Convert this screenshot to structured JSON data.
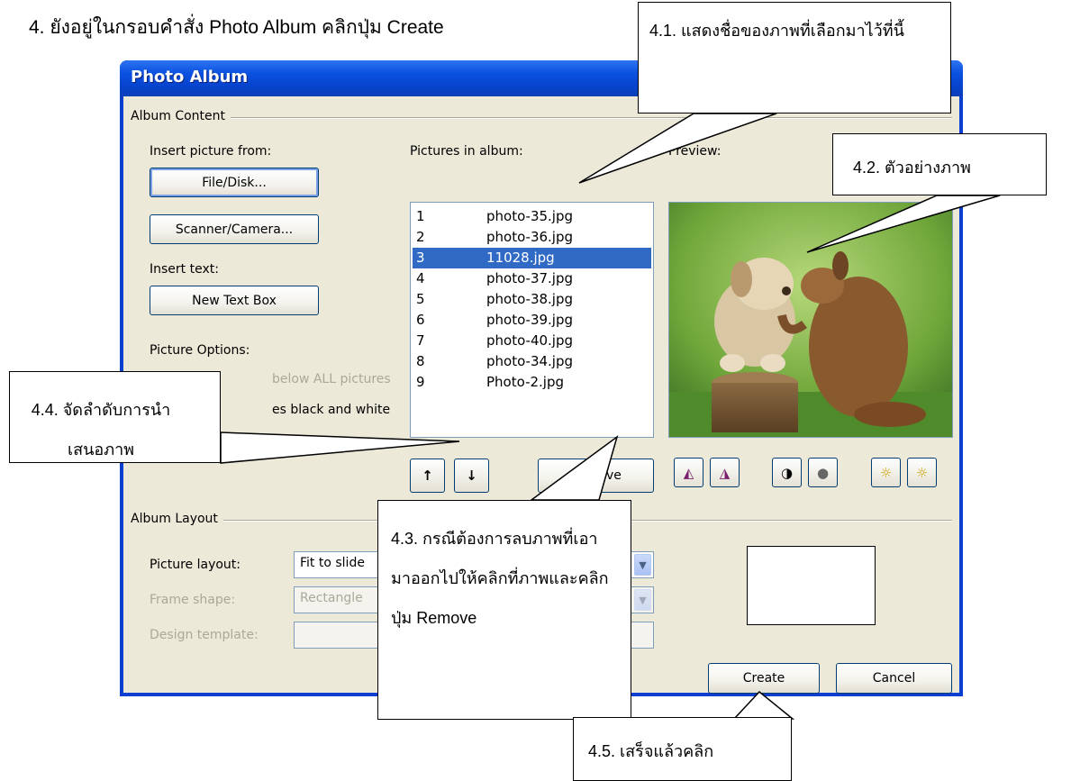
{
  "step_instruction": "4.   ยังอยู่ในกรอบคำสั่ง Photo Album คลิกปุ่ม Create",
  "dialog": {
    "title": "Photo Album",
    "album_content_label": "Album Content",
    "insert_picture_from_label": "Insert picture from:",
    "file_disk_button": "File/Disk...",
    "scanner_camera_button": "Scanner/Camera...",
    "insert_text_label": "Insert text:",
    "new_text_box_button": "New Text Box",
    "picture_options_label": "Picture Options:",
    "captions_option_visible": "below ALL pictures",
    "black_white_option_visible": "es black and white",
    "pictures_in_album_label": "Pictures in album:",
    "pictures": [
      {
        "num": "1",
        "name": "photo-35.jpg",
        "selected": false
      },
      {
        "num": "2",
        "name": "photo-36.jpg",
        "selected": false
      },
      {
        "num": "3",
        "name": "11028.jpg",
        "selected": true
      },
      {
        "num": "4",
        "name": "photo-37.jpg",
        "selected": false
      },
      {
        "num": "5",
        "name": "photo-38.jpg",
        "selected": false
      },
      {
        "num": "6",
        "name": "photo-39.jpg",
        "selected": false
      },
      {
        "num": "7",
        "name": "photo-40.jpg",
        "selected": false
      },
      {
        "num": "8",
        "name": "photo-34.jpg",
        "selected": false
      },
      {
        "num": "9",
        "name": "Photo-2.jpg",
        "selected": false
      }
    ],
    "preview_label": "Preview:",
    "remove_button": "Remove",
    "album_layout_label": "Album Layout",
    "picture_layout_label": "Picture layout:",
    "picture_layout_value": "Fit to slide",
    "frame_shape_label": "Frame shape:",
    "frame_shape_value": "Rectangle",
    "design_template_label": "Design template:",
    "create_button": "Create",
    "cancel_button": "Cancel"
  },
  "callouts": {
    "c41": "4.1. แสดงชื่อของภาพที่เลือกมาไว้ที่นี้",
    "c42": "4.2. ตัวอย่างภาพ",
    "c43": "4.3. กรณีต้องการลบภาพที่เอามาออกไปให้คลิกที่ภาพและคลิกปุ่ม Remove",
    "c44": "4.4. จัดลำดับการนำเสนอภาพ",
    "c45": "4.5. เสร็จแล้วคลิก"
  },
  "colors": {
    "title_bar": "#0b52e0",
    "dialog_bg": "#ece9d8",
    "selection": "#316ac5"
  }
}
